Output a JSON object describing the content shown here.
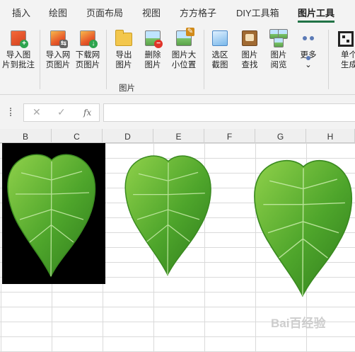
{
  "tabs": [
    {
      "label": "插入"
    },
    {
      "label": "绘图"
    },
    {
      "label": "页面布局"
    },
    {
      "label": "视图"
    },
    {
      "label": "方方格子"
    },
    {
      "label": "DIY工具箱"
    },
    {
      "label": "图片工具",
      "active": true
    }
  ],
  "ribbon": {
    "buttons": [
      {
        "line1": "导入图",
        "line2": "片到批注",
        "icon": "import-image-to-comment-icon"
      },
      {
        "line1": "导入网",
        "line2": "页图片",
        "icon": "import-web-image-icon"
      },
      {
        "line1": "下载网",
        "line2": "页图片",
        "icon": "download-web-image-icon"
      },
      {
        "line1": "导出",
        "line2": "图片",
        "icon": "export-image-folder-icon"
      },
      {
        "line1": "删除",
        "line2": "图片",
        "icon": "delete-image-icon"
      },
      {
        "line1": "图片大",
        "line2": "小位置",
        "icon": "image-size-position-icon"
      },
      {
        "line1": "选区",
        "line2": "截图",
        "icon": "selection-screenshot-icon"
      },
      {
        "line1": "图片",
        "line2": "查找",
        "icon": "image-find-icon"
      },
      {
        "line1": "图片",
        "line2": "阅览",
        "icon": "image-preview-icon"
      },
      {
        "line1": "更多",
        "line2": "⌄",
        "icon": "more-dots-icon"
      },
      {
        "line1": "单个",
        "line2": "生成",
        "icon": "qr-code-icon"
      }
    ],
    "group_label": "图片"
  },
  "formula_bar": {
    "cancel_glyph": "✕",
    "confirm_glyph": "✓",
    "fx_glyph": "fx",
    "value": ""
  },
  "columns": [
    "B",
    "C",
    "D",
    "E",
    "F",
    "G",
    "H"
  ],
  "watermark": "Bai百经验"
}
